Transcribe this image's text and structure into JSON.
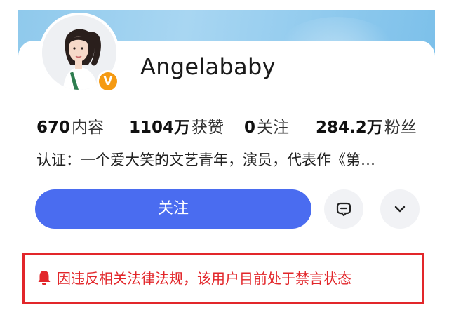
{
  "profile": {
    "username": "Angelababy",
    "verified_mark": "V",
    "avatar": "avatar-photo"
  },
  "stats": [
    {
      "value": "670",
      "label": "内容"
    },
    {
      "value": "1104万",
      "label": "获赞"
    },
    {
      "value": "0",
      "label": "关注"
    },
    {
      "value": "284.2万",
      "label": "粉丝"
    }
  ],
  "bio": "认证：一个爱大笑的文艺青年，演员，代表作《第…",
  "actions": {
    "follow_label": "关注",
    "message_icon": "message-icon",
    "more_icon": "chevron-down-icon"
  },
  "notice": {
    "icon": "bell-icon",
    "text": "因违反相关法律法规，该用户目前处于禁言状态"
  },
  "colors": {
    "follow_button": "#4a6cf0",
    "notice_red": "#e2262a",
    "verified_badge": "#f59a12",
    "banner": "#8fc9ec"
  }
}
